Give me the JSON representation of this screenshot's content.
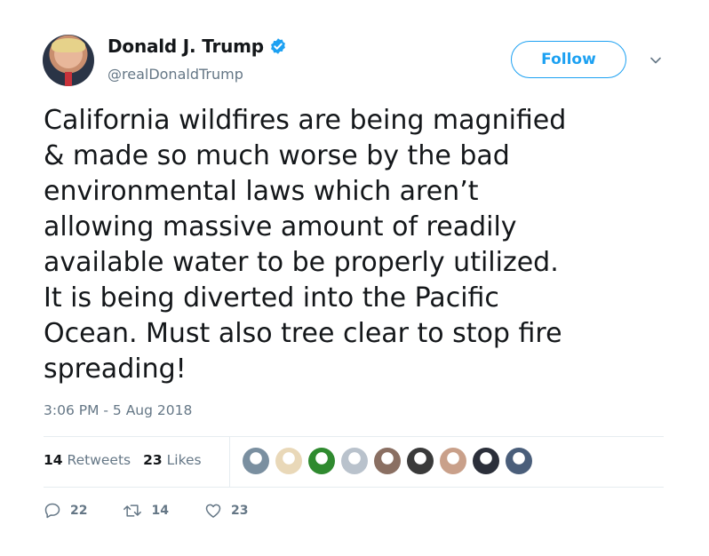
{
  "author": {
    "name": "Donald J. Trump",
    "handle": "@realDonaldTrump",
    "verified": true
  },
  "follow_label": "Follow",
  "tweet": {
    "text": "California wildfires are being magnified\n& made so much worse by the bad\nenvironmental laws which aren’t\nallowing massive amount of readily\navailable water to be properly utilized.\nIt is being diverted into the Pacific\nOcean. Must also tree clear to stop fire\nspreading!",
    "timestamp": "3:06 PM - 5 Aug 2018"
  },
  "stats": {
    "retweets_count": "14",
    "retweets_label": "Retweets",
    "likes_count": "23",
    "likes_label": "Likes"
  },
  "likers": [
    {
      "color": "#7a8fa0"
    },
    {
      "color": "#e9d8b8"
    },
    {
      "color": "#2f8a2f"
    },
    {
      "color": "#b9c2cc"
    },
    {
      "color": "#8a6f62"
    },
    {
      "color": "#3a3a3a"
    },
    {
      "color": "#c9a08a"
    },
    {
      "color": "#2b2f3a"
    },
    {
      "color": "#4a5e7a"
    }
  ],
  "actions": {
    "reply_count": "22",
    "retweet_count": "14",
    "like_count": "23"
  },
  "colors": {
    "accent": "#1da1f2",
    "muted": "#657786"
  }
}
